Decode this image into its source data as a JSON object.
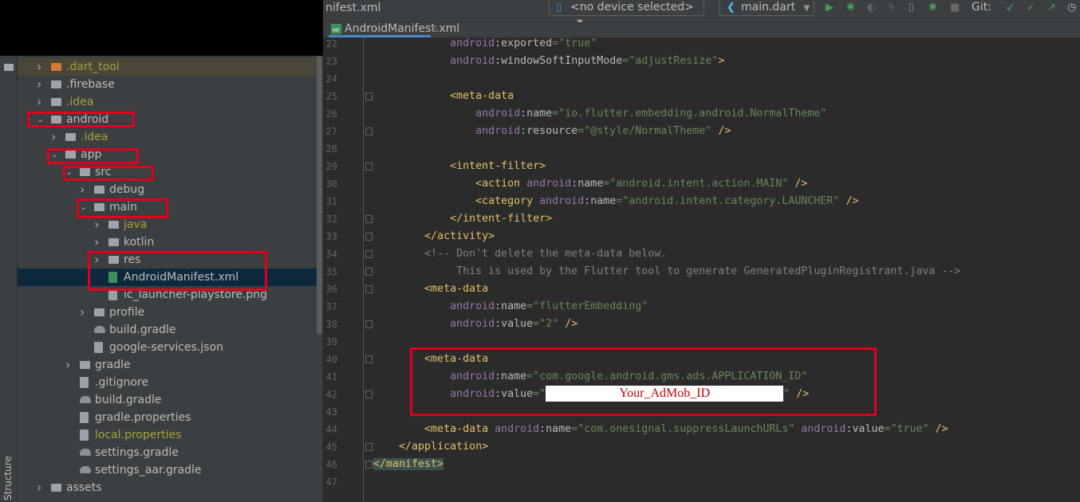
{
  "toolbar": {
    "file_crumb": "nifest.xml",
    "device_selector": "<no device selected>",
    "run_config": "main.dart",
    "git_label": "Git:",
    "icons": [
      "phone-icon",
      "flutter-icon",
      "run-icon",
      "debug-icon",
      "profile-icon",
      "hot-reload-icon",
      "device-manager-icon",
      "attach-debugger-icon",
      "stop-icon",
      "git-update-icon",
      "git-commit-icon",
      "git-push-icon",
      "history-icon"
    ],
    "colors": {
      "run": "#499c54",
      "git_update": "#3592c4",
      "git_commit": "#499c54"
    }
  },
  "tab": {
    "label": "AndroidManifest.xml",
    "badge": "MF"
  },
  "sidebar": {
    "rail_label": "Structure",
    "tree": [
      {
        "name": ".dart_tool",
        "level": 0,
        "chevron": "right",
        "icon": "folder-orange",
        "color": "#a5a33a",
        "highlight": true
      },
      {
        "name": ".firebase",
        "level": 0,
        "chevron": "right",
        "icon": "folder"
      },
      {
        "name": ".idea",
        "level": 0,
        "chevron": "right",
        "icon": "folder-settings",
        "color": "#a5a33a"
      },
      {
        "name": "android",
        "level": 0,
        "chevron": "down",
        "icon": "folder-module"
      },
      {
        "name": ".idea",
        "level": 1,
        "chevron": "right",
        "icon": "folder-settings",
        "color": "#a5a33a"
      },
      {
        "name": "app",
        "level": 1,
        "chevron": "down",
        "icon": "folder"
      },
      {
        "name": "src",
        "level": 2,
        "chevron": "down",
        "icon": "folder"
      },
      {
        "name": "debug",
        "level": 3,
        "chevron": "right",
        "icon": "folder"
      },
      {
        "name": "main",
        "level": 3,
        "chevron": "down",
        "icon": "folder"
      },
      {
        "name": "java",
        "level": 4,
        "chevron": "right",
        "icon": "folder",
        "color": "#a5a33a"
      },
      {
        "name": "kotlin",
        "level": 4,
        "chevron": "right",
        "icon": "folder"
      },
      {
        "name": "res",
        "level": 4,
        "chevron": "right",
        "icon": "folder"
      },
      {
        "name": "AndroidManifest.xml",
        "level": 4,
        "chevron": "",
        "icon": "manifest-file",
        "selected": true
      },
      {
        "name": "ic_launcher-playstore.png",
        "level": 4,
        "chevron": "",
        "icon": "image-file"
      },
      {
        "name": "profile",
        "level": 3,
        "chevron": "right",
        "icon": "folder"
      },
      {
        "name": "build.gradle",
        "level": 3,
        "chevron": "",
        "icon": "gradle-file"
      },
      {
        "name": "google-services.json",
        "level": 3,
        "chevron": "",
        "icon": "json-file"
      },
      {
        "name": "gradle",
        "level": 2,
        "chevron": "right",
        "icon": "folder"
      },
      {
        "name": ".gitignore",
        "level": 2,
        "chevron": "",
        "icon": "ignore-file"
      },
      {
        "name": "build.gradle",
        "level": 2,
        "chevron": "",
        "icon": "gradle-file"
      },
      {
        "name": "gradle.properties",
        "level": 2,
        "chevron": "",
        "icon": "properties-file"
      },
      {
        "name": "local.properties",
        "level": 2,
        "chevron": "",
        "icon": "properties-file",
        "color": "#a5a33a"
      },
      {
        "name": "settings.gradle",
        "level": 2,
        "chevron": "",
        "icon": "gradle-file"
      },
      {
        "name": "settings_aar.gradle",
        "level": 2,
        "chevron": "",
        "icon": "gradle-file"
      },
      {
        "name": "assets",
        "level": 0,
        "chevron": "right",
        "icon": "folder"
      }
    ]
  },
  "editor": {
    "masked_value": "Your_AdMob_ID",
    "lines": [
      {
        "n": "22",
        "fold": false,
        "tokens": [
          [
            "p",
            "            "
          ],
          [
            "n",
            "android"
          ],
          [
            "a",
            ":exported"
          ],
          [
            "s",
            "=\"true\""
          ]
        ]
      },
      {
        "n": "23",
        "fold": false,
        "tokens": [
          [
            "p",
            "            "
          ],
          [
            "n",
            "android"
          ],
          [
            "a",
            ":windowSoftInputMode"
          ],
          [
            "s",
            "=\"adjustResize\""
          ],
          [
            "t",
            ">"
          ]
        ]
      },
      {
        "n": "24",
        "fold": false,
        "tokens": []
      },
      {
        "n": "25",
        "fold": true,
        "tokens": [
          [
            "p",
            "            "
          ],
          [
            "t",
            "<meta-data"
          ]
        ]
      },
      {
        "n": "26",
        "fold": false,
        "tokens": [
          [
            "p",
            "                "
          ],
          [
            "n",
            "android"
          ],
          [
            "a",
            ":name"
          ],
          [
            "s",
            "=\"io.flutter.embedding.android.NormalTheme\""
          ]
        ]
      },
      {
        "n": "27",
        "fold": true,
        "tokens": [
          [
            "p",
            "                "
          ],
          [
            "n",
            "android"
          ],
          [
            "a",
            ":resource"
          ],
          [
            "s",
            "=\"@style/NormalTheme\""
          ],
          [
            "t",
            " />"
          ]
        ]
      },
      {
        "n": "28",
        "fold": false,
        "tokens": []
      },
      {
        "n": "29",
        "fold": true,
        "tokens": [
          [
            "p",
            "            "
          ],
          [
            "t",
            "<intent-filter>"
          ]
        ]
      },
      {
        "n": "30",
        "fold": false,
        "tokens": [
          [
            "p",
            "                "
          ],
          [
            "t",
            "<action "
          ],
          [
            "n",
            "android"
          ],
          [
            "a",
            ":name"
          ],
          [
            "s",
            "=\"android.intent.action.MAIN\""
          ],
          [
            "t",
            " />"
          ]
        ]
      },
      {
        "n": "31",
        "fold": false,
        "tokens": [
          [
            "p",
            "                "
          ],
          [
            "t",
            "<category "
          ],
          [
            "n",
            "android"
          ],
          [
            "a",
            ":name"
          ],
          [
            "s",
            "=\"android.intent.category.LAUNCHER\""
          ],
          [
            "t",
            " />"
          ]
        ]
      },
      {
        "n": "32",
        "fold": true,
        "tokens": [
          [
            "p",
            "            "
          ],
          [
            "t",
            "</intent-filter>"
          ]
        ]
      },
      {
        "n": "33",
        "fold": true,
        "tokens": [
          [
            "p",
            "        "
          ],
          [
            "t",
            "</activity>"
          ]
        ]
      },
      {
        "n": "34",
        "fold": true,
        "tokens": [
          [
            "p",
            "        "
          ],
          [
            "c",
            "<!-- Don't delete the meta-data below."
          ]
        ]
      },
      {
        "n": "35",
        "fold": true,
        "tokens": [
          [
            "p",
            "        "
          ],
          [
            "c",
            "     This is used by the Flutter tool to generate GeneratedPluginRegistrant.java -->"
          ]
        ]
      },
      {
        "n": "36",
        "fold": true,
        "tokens": [
          [
            "p",
            "        "
          ],
          [
            "t",
            "<meta-data"
          ]
        ]
      },
      {
        "n": "37",
        "fold": false,
        "tokens": [
          [
            "p",
            "            "
          ],
          [
            "n",
            "android"
          ],
          [
            "a",
            ":name"
          ],
          [
            "s",
            "=\"flutterEmbedding\""
          ]
        ]
      },
      {
        "n": "38",
        "fold": true,
        "tokens": [
          [
            "p",
            "            "
          ],
          [
            "n",
            "android"
          ],
          [
            "a",
            ":value"
          ],
          [
            "s",
            "=\"2\""
          ],
          [
            "t",
            " />"
          ]
        ]
      },
      {
        "n": "39",
        "fold": false,
        "tokens": []
      },
      {
        "n": "40",
        "fold": true,
        "tokens": [
          [
            "p",
            "        "
          ],
          [
            "t",
            "<meta-data"
          ]
        ]
      },
      {
        "n": "41",
        "fold": false,
        "tokens": [
          [
            "p",
            "            "
          ],
          [
            "n",
            "android"
          ],
          [
            "a",
            ":name"
          ],
          [
            "s",
            "=\"com.google.android.gms.ads.APPLICATION_ID\""
          ]
        ]
      },
      {
        "n": "42",
        "fold": true,
        "tokens": [
          [
            "p",
            "            "
          ],
          [
            "n",
            "android"
          ],
          [
            "a",
            ":value"
          ],
          [
            "s",
            "=\""
          ],
          [
            "mask",
            ""
          ],
          [
            "s",
            "\""
          ],
          [
            "t",
            " />"
          ]
        ]
      },
      {
        "n": "43",
        "fold": false,
        "tokens": []
      },
      {
        "n": "44",
        "fold": false,
        "tokens": [
          [
            "p",
            "        "
          ],
          [
            "t",
            "<meta-data "
          ],
          [
            "n",
            "android"
          ],
          [
            "a",
            ":name"
          ],
          [
            "s",
            "=\"com.onesignal.suppressLaunchURLs\" "
          ],
          [
            "n",
            "android"
          ],
          [
            "a",
            ":value"
          ],
          [
            "s",
            "=\"true\""
          ],
          [
            "t",
            " />"
          ]
        ]
      },
      {
        "n": "45",
        "fold": true,
        "tokens": [
          [
            "p",
            "    "
          ],
          [
            "t",
            "</application>"
          ]
        ]
      },
      {
        "n": "46",
        "fold": true,
        "tokens": [
          [
            "hl",
            "</manifest>"
          ]
        ]
      },
      {
        "n": "47",
        "fold": false,
        "tokens": []
      }
    ]
  },
  "annotation_color": "#e0001b"
}
